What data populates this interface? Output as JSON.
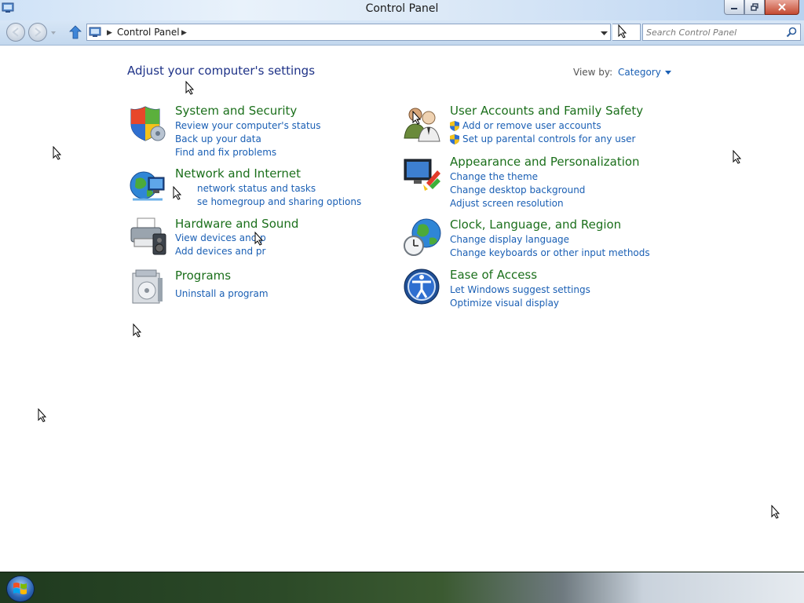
{
  "window": {
    "title": "Control Panel"
  },
  "address_bar": {
    "crumb": "Control Panel",
    "search_placeholder": "Search Control Panel"
  },
  "content": {
    "heading": "Adjust your computer's settings",
    "view_by_label": "View by:",
    "view_by_value": "Category"
  },
  "categories": {
    "system_security": {
      "title": "System and Security",
      "icon": "shield-icon",
      "links": [
        "Review your computer's status",
        "Back up your data",
        "Find and fix problems"
      ]
    },
    "network_internet": {
      "title": "Network and Internet",
      "icon": "network-globe-icon",
      "links": [
        "network status and tasks",
        "se homegroup and sharing options"
      ]
    },
    "hardware_sound": {
      "title": "Hardware and Sound",
      "icon": "printer-speaker-icon",
      "links": [
        "View devices and p",
        "Add devices and pr"
      ]
    },
    "programs": {
      "title": "Programs",
      "icon": "programs-box-icon",
      "links": [
        "Uninstall a program"
      ]
    },
    "user_accounts": {
      "title": "User Accounts and Family Safety",
      "icon": "users-icon",
      "links": [
        "Add or remove user accounts",
        "Set up parental controls for any user"
      ]
    },
    "appearance": {
      "title": "Appearance and Personalization",
      "icon": "monitor-paint-icon",
      "links": [
        "Change the theme",
        "Change desktop background",
        "Adjust screen resolution"
      ]
    },
    "clock_language": {
      "title": "Clock, Language, and Region",
      "icon": "clock-globe-icon",
      "links": [
        "Change display language",
        "Change keyboards or other input methods"
      ]
    },
    "ease_access": {
      "title": "Ease of Access",
      "icon": "ease-of-access-icon",
      "links": [
        "Let Windows suggest settings",
        "Optimize visual display"
      ]
    }
  },
  "colors": {
    "heading": "#1e3287",
    "category_title": "#1b6f1b",
    "link": "#1a5fb4"
  }
}
